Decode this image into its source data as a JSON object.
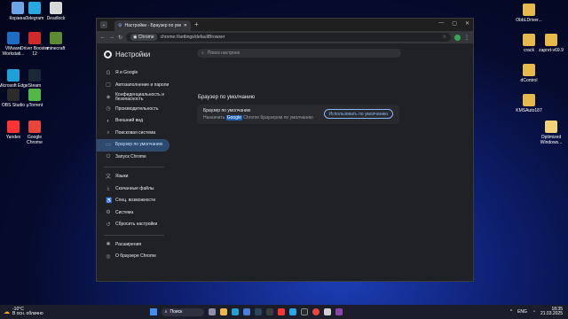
{
  "desktop_left": [
    {
      "label": "Корзина",
      "color": "#6aa6e8"
    },
    {
      "label": "Telegram",
      "color": "#29a7e1"
    },
    {
      "label": "Deadlock",
      "color": "#d8d8d8"
    },
    {
      "label": "VMware Workstati...",
      "color": "#1e6cc4"
    },
    {
      "label": "Driver Booster 12",
      "color": "#d02a2a"
    },
    {
      "label": "minecraft",
      "color": "#5b8a32"
    },
    {
      "label": "Microsoft Edge",
      "color": "#1fa1d8"
    },
    {
      "label": "Steam",
      "color": "#1b2838"
    },
    {
      "label": "OBS Studio",
      "color": "#2b2b2b"
    },
    {
      "label": "µTorrent",
      "color": "#51b848"
    },
    {
      "label": "Yandex",
      "color": "#ff3333"
    },
    {
      "label": "Google Chrome",
      "color": "#e8453c"
    }
  ],
  "desktop_right": [
    {
      "label": "ObbLDriver...",
      "type": "folder"
    },
    {
      "label": "crack",
      "type": "folder"
    },
    {
      "label": "zapret-v69.9",
      "type": "folder"
    },
    {
      "label": "dControl",
      "type": "folder"
    },
    {
      "label": "KMSAuto187",
      "type": "folder"
    },
    {
      "label": "Optimized Windows...",
      "type": "folder-light"
    }
  ],
  "window": {
    "tab_title": "Настройки - Браузер по умолч",
    "new_tab": "+",
    "url_pill": "Chrome",
    "url": "chrome://settings/defaultBrowser",
    "brand": "Настройки",
    "search_placeholder": "Поиск настроек",
    "nav": [
      {
        "label": "Я и Google",
        "icon": "G"
      },
      {
        "label": "Автозаполнение и пароли",
        "icon": "▢"
      },
      {
        "label": "Конфиденциальность и безопасность",
        "icon": "◈"
      },
      {
        "label": "Производительность",
        "icon": "◷"
      },
      {
        "label": "Внешний вид",
        "icon": "◐"
      },
      {
        "label": "Поисковая система",
        "icon": "⌕"
      },
      {
        "label": "Браузер по умолчанию",
        "icon": "▭",
        "active": true
      },
      {
        "label": "Запуск Chrome",
        "icon": "⏻"
      }
    ],
    "nav2": [
      {
        "label": "Языки",
        "icon": "文"
      },
      {
        "label": "Скачанные файлы",
        "icon": "⤓"
      },
      {
        "label": "Спец. возможности",
        "icon": "♿"
      },
      {
        "label": "Система",
        "icon": "⚙"
      },
      {
        "label": "Сбросить настройки",
        "icon": "↺"
      }
    ],
    "nav3": [
      {
        "label": "Расширения",
        "icon": "✱"
      },
      {
        "label": "О браузере Chrome",
        "icon": "◎"
      }
    ],
    "section_title": "Браузер по умолчанию",
    "card_title": "Браузер по умолчанию",
    "card_desc_pre": "Назначить ",
    "card_desc_sel": "Google",
    "card_desc_post": " Chrome браузером по умолчанию",
    "card_button": "Использовать по умолчанию"
  },
  "taskbar": {
    "weather_temp": "-10°C",
    "weather_desc": "В осн. облачно",
    "search": "Поиск",
    "lang": "ENG",
    "time": "18:35",
    "date": "21.03.2025"
  }
}
